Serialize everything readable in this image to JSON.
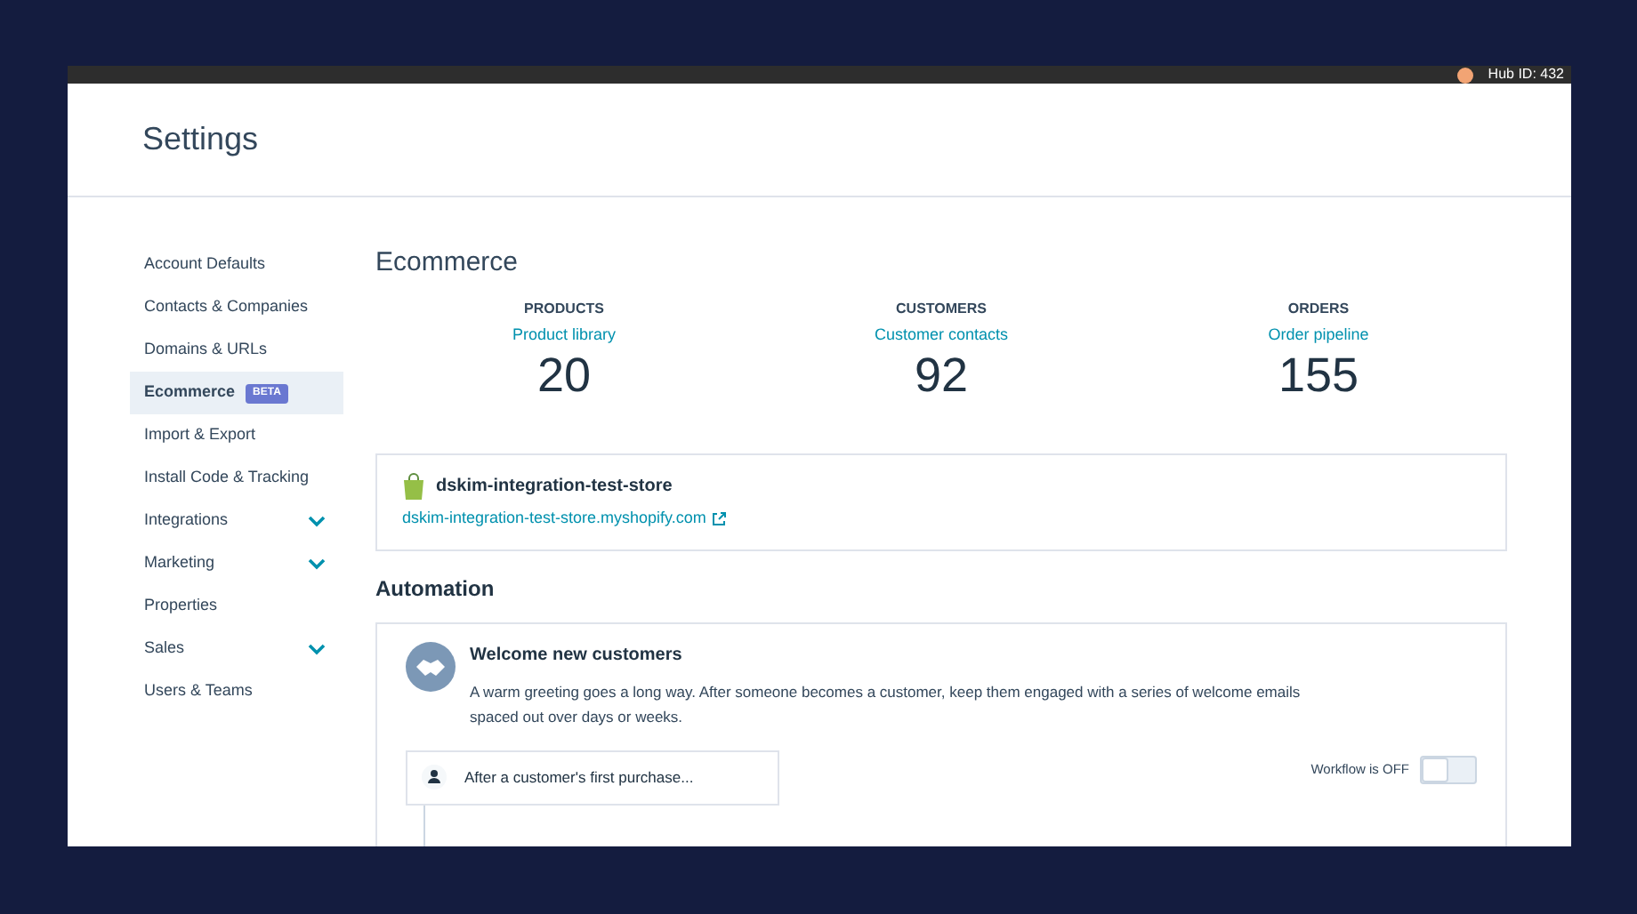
{
  "top_bar": {
    "hub_id": "Hub ID: 432"
  },
  "page_title": "Settings",
  "sidebar": {
    "items": [
      {
        "label": "Account Defaults",
        "selected": false,
        "expandable": false
      },
      {
        "label": "Contacts & Companies",
        "selected": false,
        "expandable": false
      },
      {
        "label": "Domains & URLs",
        "selected": false,
        "expandable": false
      },
      {
        "label": "Ecommerce",
        "selected": true,
        "expandable": false,
        "badge": "BETA"
      },
      {
        "label": "Import & Export",
        "selected": false,
        "expandable": false
      },
      {
        "label": "Install Code & Tracking",
        "selected": false,
        "expandable": false
      },
      {
        "label": "Integrations",
        "selected": false,
        "expandable": true
      },
      {
        "label": "Marketing",
        "selected": false,
        "expandable": true
      },
      {
        "label": "Properties",
        "selected": false,
        "expandable": false
      },
      {
        "label": "Sales",
        "selected": false,
        "expandable": true
      },
      {
        "label": "Users & Teams",
        "selected": false,
        "expandable": false
      }
    ]
  },
  "section_title": "Ecommerce",
  "stats": [
    {
      "label": "PRODUCTS",
      "link": "Product library",
      "value": "20"
    },
    {
      "label": "CUSTOMERS",
      "link": "Customer contacts",
      "value": "92"
    },
    {
      "label": "ORDERS",
      "link": "Order pipeline",
      "value": "155"
    }
  ],
  "store": {
    "name": "dskim-integration-test-store",
    "url": "dskim-integration-test-store.myshopify.com"
  },
  "automation": {
    "title": "Automation",
    "card": {
      "title": "Welcome new customers",
      "description": "A warm greeting goes a long way. After someone becomes a customer, keep them engaged with a series of welcome emails spaced out over days or weeks.",
      "trigger": "After a customer's first purchase...",
      "workflow_status": "Workflow is OFF",
      "on": false
    }
  }
}
